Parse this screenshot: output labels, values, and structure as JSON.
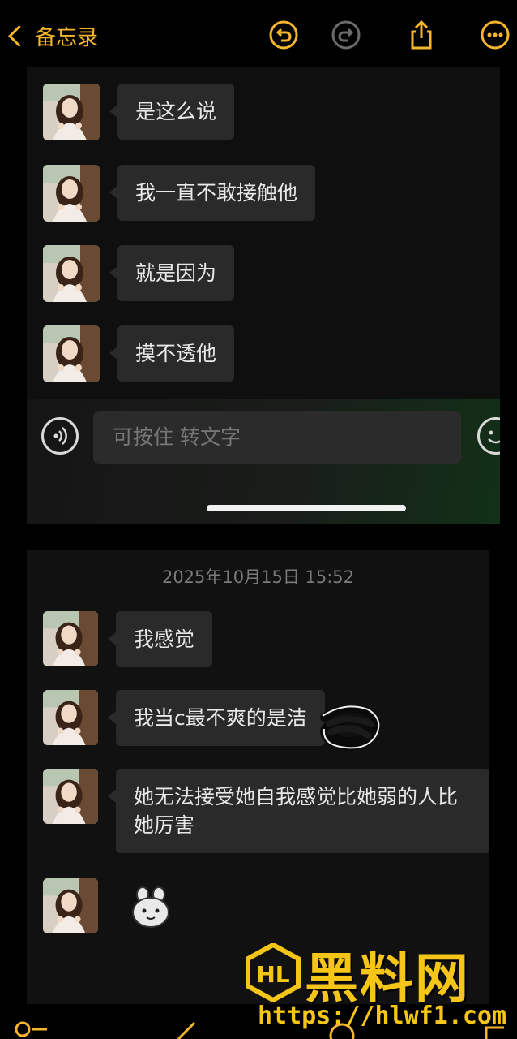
{
  "topbar": {
    "back_label": "备忘录",
    "icons": [
      "undo-icon",
      "redo-icon",
      "share-icon",
      "more-icon"
    ]
  },
  "screenshot_top": {
    "messages": [
      {
        "text": "是这么说"
      },
      {
        "text": "我一直不敢接触他"
      },
      {
        "text": "就是因为"
      },
      {
        "text": "摸不透他"
      }
    ],
    "input_placeholder": "可按住 转文字"
  },
  "screenshot_bottom": {
    "timestamp": "2025年10月15日 15:52",
    "messages": [
      {
        "text": "我感觉"
      },
      {
        "text": "我当c最不爽的是洁"
      },
      {
        "text": "她无法接受她自我感觉比她弱的人比她厉害"
      }
    ],
    "sticker": "rabbit-sticker"
  },
  "watermark": {
    "cn": "黑料网",
    "url": "https://hlwf1.com"
  },
  "colors": {
    "accent": "#f5b52e",
    "bubble": "#2a2a2a",
    "watermark": "#f5c518"
  }
}
